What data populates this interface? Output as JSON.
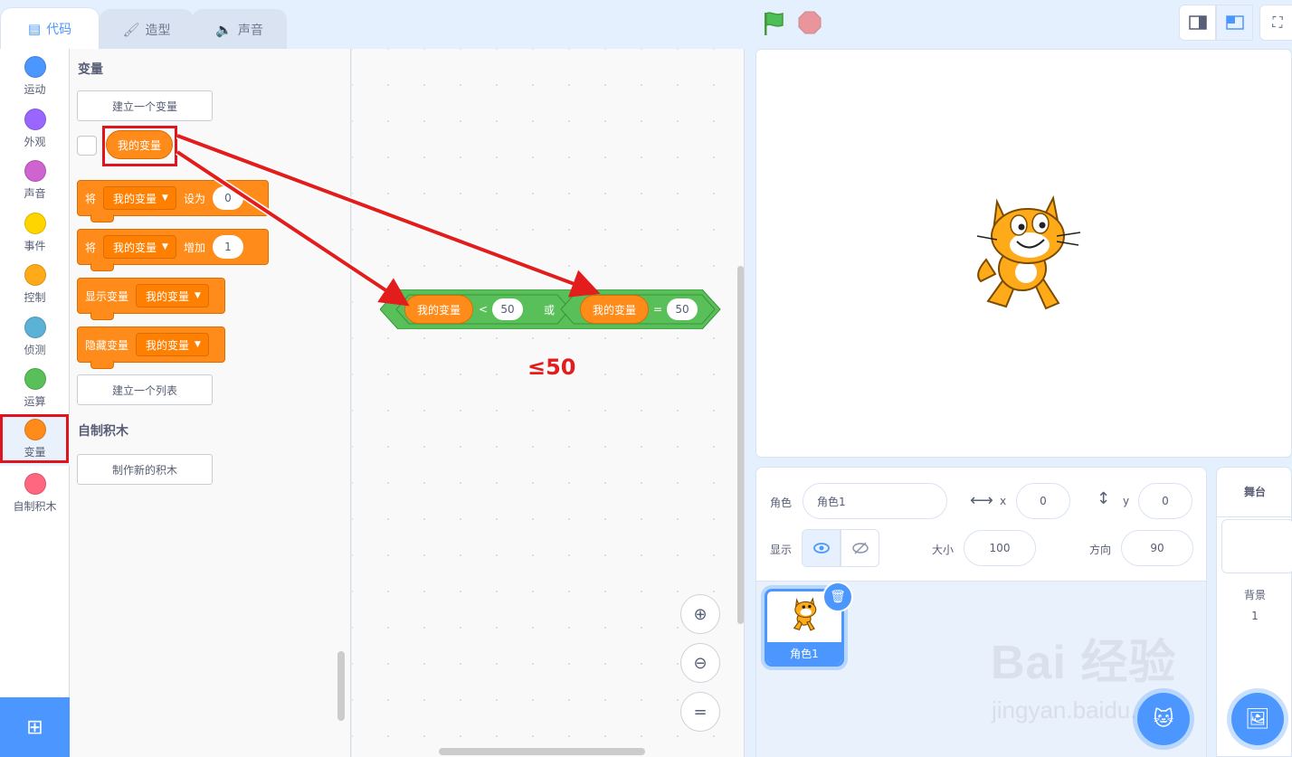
{
  "tabs": [
    {
      "label": "代码",
      "icon": "code-icon",
      "active": true
    },
    {
      "label": "造型",
      "icon": "brush-icon",
      "active": false
    },
    {
      "label": "声音",
      "icon": "speaker-icon",
      "active": false
    }
  ],
  "categories": [
    {
      "label": "运动",
      "color": "#4c97ff"
    },
    {
      "label": "外观",
      "color": "#9966ff"
    },
    {
      "label": "声音",
      "color": "#cf63cf"
    },
    {
      "label": "事件",
      "color": "#ffd500"
    },
    {
      "label": "控制",
      "color": "#ffab19"
    },
    {
      "label": "侦测",
      "color": "#5cb1d6"
    },
    {
      "label": "运算",
      "color": "#59c059"
    },
    {
      "label": "变量",
      "color": "#ff8c1a",
      "selected": true
    },
    {
      "label": "自制积木",
      "color": "#ff6680"
    }
  ],
  "palette": {
    "variables_title": "变量",
    "make_variable": "建立一个变量",
    "variable_reporter": "我的变量",
    "set_block": {
      "prefix": "将",
      "var": "我的变量",
      "mid": "设为",
      "value": "0"
    },
    "change_block": {
      "prefix": "将",
      "var": "我的变量",
      "mid": "增加",
      "value": "1"
    },
    "show_block": {
      "prefix": "显示变量",
      "var": "我的变量"
    },
    "hide_block": {
      "prefix": "隐藏变量",
      "var": "我的变量"
    },
    "make_list": "建立一个列表",
    "myblocks_title": "自制积木",
    "make_block": "制作新的积木"
  },
  "workspace": {
    "or_block": {
      "left": {
        "var": "我的变量",
        "op": "<",
        "value": "50"
      },
      "joiner": "或",
      "right": {
        "var": "我的变量",
        "op": "=",
        "value": "50"
      }
    },
    "annotation": "≤50"
  },
  "sprite_info": {
    "sprite_label": "角色",
    "sprite_name": "角色1",
    "x_label": "x",
    "x_value": "0",
    "y_label": "y",
    "y_value": "0",
    "show_label": "显示",
    "size_label": "大小",
    "size_value": "100",
    "direction_label": "方向",
    "direction_value": "90"
  },
  "sprites": [
    {
      "name": "角色1"
    }
  ],
  "stage_pane": {
    "title": "舞台",
    "backdrop_label": "背景",
    "backdrop_count": "1"
  },
  "watermark": {
    "main": "Bai 经验",
    "sub": "jingyan.baidu.com"
  },
  "colors": {
    "accent": "#4c97ff",
    "variables": "#ff8c1a",
    "operators": "#59c059",
    "highlight": "#e0141c"
  }
}
